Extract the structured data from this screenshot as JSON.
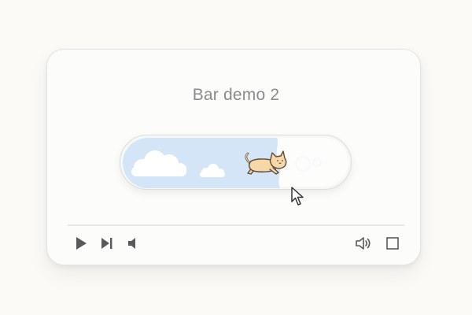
{
  "player": {
    "title": "Bar demo 2"
  },
  "progress": {
    "value_percent": 72,
    "fill_color": "#d3e5f7",
    "track_color": "#fdfdfc",
    "thumb": "running-cat-icon"
  },
  "controls": {
    "left": [
      "play-icon",
      "skip-next-icon",
      "volume-low-icon"
    ],
    "right": [
      "volume-high-icon",
      "fullscreen-icon"
    ]
  },
  "colors": {
    "icon": "#5a5a5a",
    "cloud": "#ffffff",
    "cat": "#f6d7a7"
  }
}
